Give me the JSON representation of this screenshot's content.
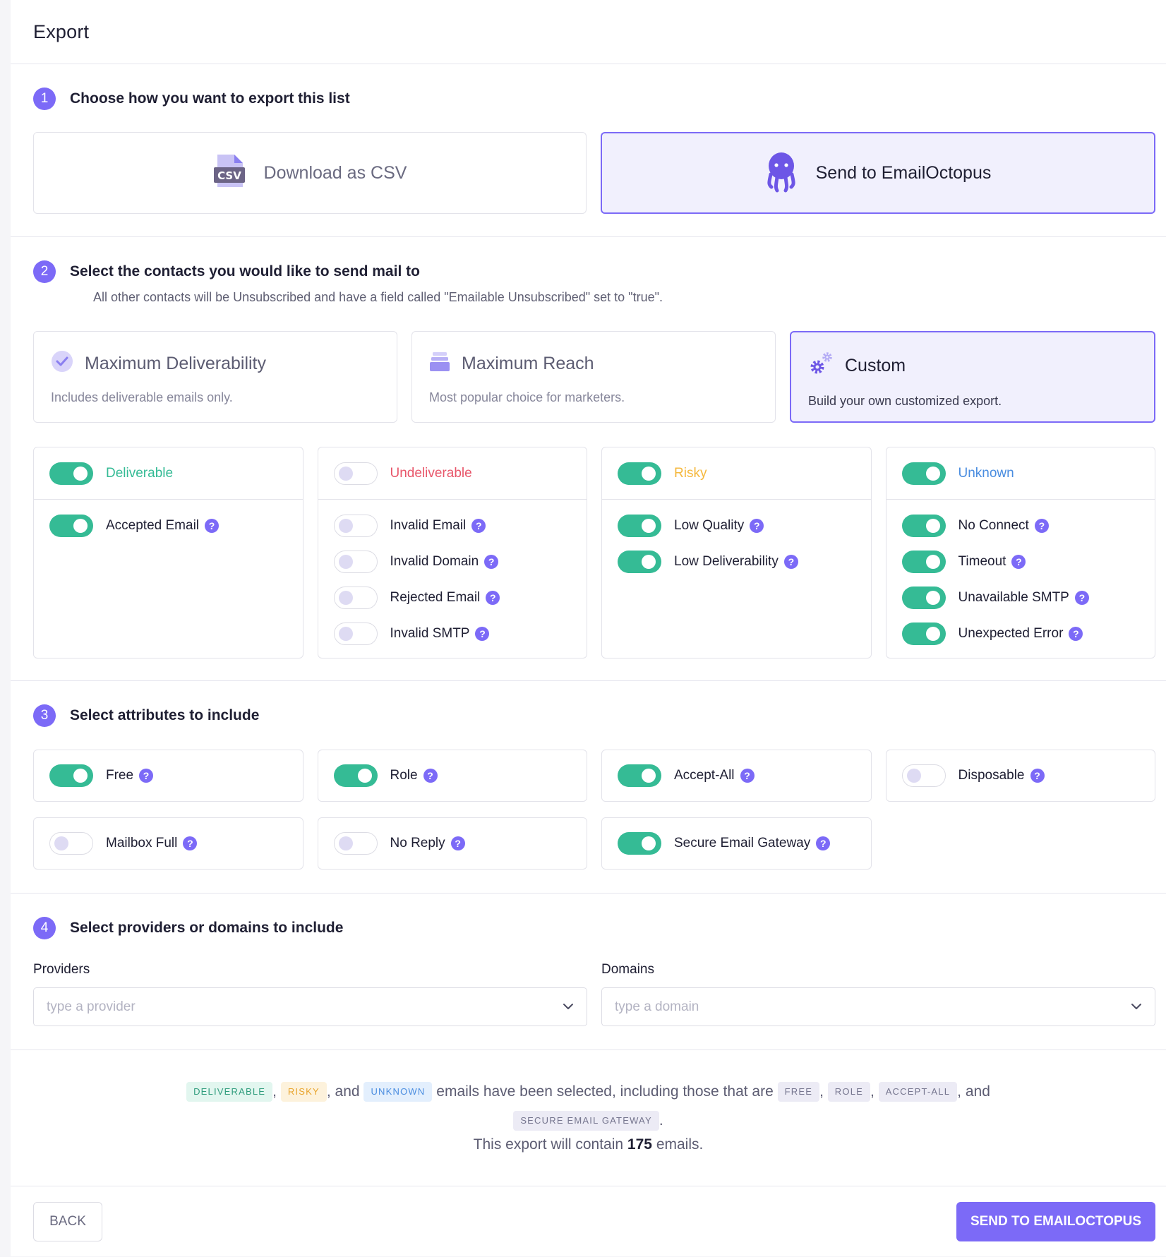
{
  "header": {
    "title": "Export"
  },
  "step1": {
    "number": "1",
    "title": "Choose how you want to export this list",
    "options": [
      {
        "label": "Download as CSV",
        "icon": "csv-file-icon",
        "csv_badge": "CSV",
        "selected": false
      },
      {
        "label": "Send to EmailOctopus",
        "icon": "octopus-icon",
        "selected": true
      }
    ]
  },
  "step2": {
    "number": "2",
    "title": "Select the contacts you would like to send mail to",
    "subtitle": "All other contacts will be Unsubscribed and have a field called \"Emailable Unsubscribed\" set to \"true\".",
    "presets": [
      {
        "title": "Maximum Deliverability",
        "desc": "Includes deliverable emails only.",
        "icon": "check-circle-icon",
        "selected": false
      },
      {
        "title": "Maximum Reach",
        "desc": "Most popular choice for marketers.",
        "icon": "inbox-stack-icon",
        "selected": false
      },
      {
        "title": "Custom",
        "desc": "Build your own customized export.",
        "icon": "gears-icon",
        "selected": true
      }
    ],
    "groups": [
      {
        "name": "Deliverable",
        "color": "#35bb95",
        "on": true,
        "items": [
          {
            "label": "Accepted Email",
            "on": true
          }
        ]
      },
      {
        "name": "Undeliverable",
        "color": "#e8566a",
        "on": false,
        "items": [
          {
            "label": "Invalid Email",
            "on": false
          },
          {
            "label": "Invalid Domain",
            "on": false
          },
          {
            "label": "Rejected Email",
            "on": false
          },
          {
            "label": "Invalid SMTP",
            "on": false
          }
        ]
      },
      {
        "name": "Risky",
        "color": "#f5b83d",
        "on": true,
        "items": [
          {
            "label": "Low Quality",
            "on": true
          },
          {
            "label": "Low Deliverability",
            "on": true
          }
        ]
      },
      {
        "name": "Unknown",
        "color": "#4a8de0",
        "on": true,
        "items": [
          {
            "label": "No Connect",
            "on": true
          },
          {
            "label": "Timeout",
            "on": true
          },
          {
            "label": "Unavailable SMTP",
            "on": true
          },
          {
            "label": "Unexpected Error",
            "on": true
          }
        ]
      }
    ]
  },
  "step3": {
    "number": "3",
    "title": "Select attributes to include",
    "attributes": [
      {
        "label": "Free",
        "on": true
      },
      {
        "label": "Role",
        "on": true
      },
      {
        "label": "Accept-All",
        "on": true
      },
      {
        "label": "Disposable",
        "on": false
      },
      {
        "label": "Mailbox Full",
        "on": false
      },
      {
        "label": "No Reply",
        "on": false
      },
      {
        "label": "Secure Email Gateway",
        "on": true
      }
    ]
  },
  "step4": {
    "number": "4",
    "title": "Select providers or domains to include",
    "providers": {
      "label": "Providers",
      "placeholder": "type a provider"
    },
    "domains": {
      "label": "Domains",
      "placeholder": "type a domain"
    }
  },
  "summary": {
    "tag_deliverable": "DELIVERABLE",
    "tag_risky": "RISKY",
    "tag_unknown": "UNKNOWN",
    "comma": ",",
    "and": ", and",
    "middle": "emails have been selected, including those that are",
    "tag_free": "FREE",
    "tag_role": "ROLE",
    "tag_accept_all": "ACCEPT-ALL",
    "tag_seg": "SECURE EMAIL GATEWAY",
    "period": ".",
    "count_prefix": "This export will contain",
    "count": "175",
    "count_suffix": "emails."
  },
  "footer": {
    "back_label": "BACK",
    "send_label": "SEND TO EMAILOCTOPUS"
  },
  "colors": {
    "accent": "#7c6af7",
    "toggle_on": "#35bb95"
  }
}
